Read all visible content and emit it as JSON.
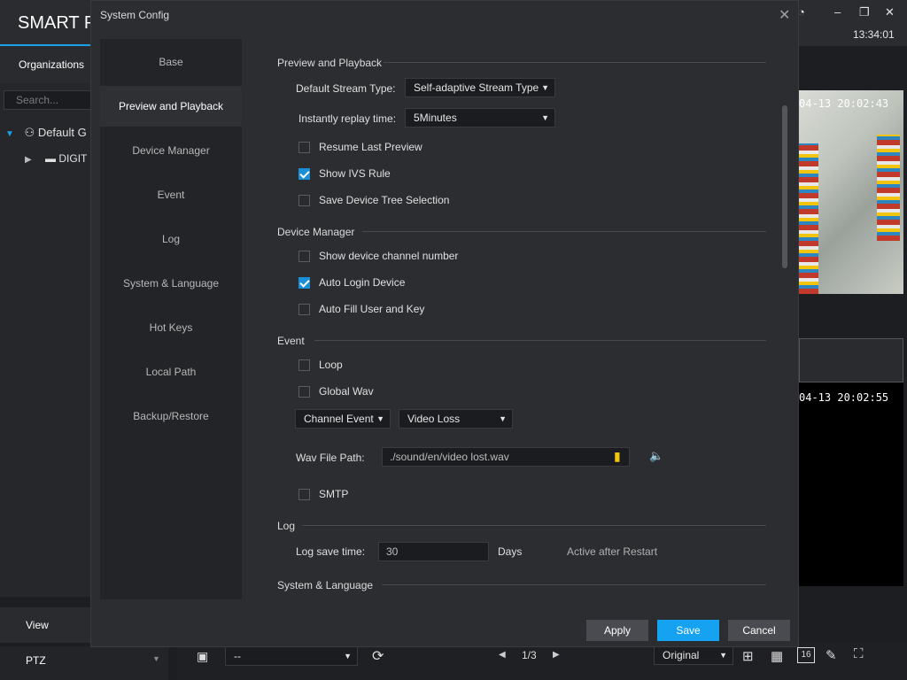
{
  "app": {
    "title": "SMART P",
    "clock": "13:34:01",
    "orgs_tab": "Organizations",
    "search_placeholder": "Search...",
    "tree_root": "Default G",
    "tree_child": "DIGIT",
    "view_label": "View",
    "ptz_label": "PTZ",
    "video1_ts": "04-13 20:02:43",
    "video2_ts": "04-13 20:02:55",
    "bottom": {
      "preset_value": "--",
      "page": "1/3",
      "stream": "Original",
      "grid16": "16"
    }
  },
  "dialog": {
    "title": "System Config",
    "sidebar": [
      "Base",
      "Preview and Playback",
      "Device Manager",
      "Event",
      "Log",
      "System & Language",
      "Hot Keys",
      "Local Path",
      "Backup/Restore"
    ],
    "preview": {
      "heading": "Preview and Playback",
      "stream_label": "Default Stream Type:",
      "stream_value": "Self-adaptive Stream Type",
      "replay_label": "Instantly replay time:",
      "replay_value": "5Minutes",
      "resume": "Resume Last Preview",
      "ivs": "Show IVS Rule",
      "save_tree": "Save Device Tree Selection"
    },
    "device": {
      "heading": "Device Manager",
      "channel_num": "Show device channel number",
      "auto_login": "Auto Login Device",
      "auto_fill": "Auto Fill User and Key"
    },
    "event": {
      "heading": "Event",
      "loop": "Loop",
      "global_wav": "Global Wav",
      "channel_event": "Channel Event",
      "video_loss": "Video Loss",
      "wav_label": "Wav File Path:",
      "wav_path": "./sound/en/video lost.wav",
      "smtp": "SMTP"
    },
    "log": {
      "heading": "Log",
      "save_label": "Log save time:",
      "save_value": "30",
      "days": "Days",
      "note": "Active after Restart"
    },
    "syslang": {
      "heading": "System & Language"
    },
    "buttons": {
      "apply": "Apply",
      "save": "Save",
      "cancel": "Cancel"
    }
  },
  "colors": {
    "accent": "#15a2f0",
    "check": "#1a8fd8"
  }
}
